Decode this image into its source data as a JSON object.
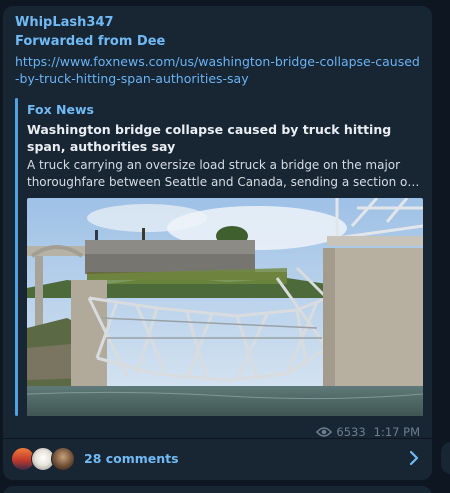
{
  "message": {
    "author": "WhipLash347",
    "forwarded_from": "Forwarded from Dee",
    "link": "https://www.foxnews.com/us/washington-bridge-collapse-caused-by-truck-hitting-span-authorities-say"
  },
  "preview": {
    "site_name": "Fox News",
    "title": "Washington bridge collapse caused by truck hitting span, authorities say",
    "description": "A truck carrying an oversize load struck a bridge on the major thoroughfare between Seattle and Canada, sending a section of the"
  },
  "meta": {
    "views": "6533",
    "time": "1:17 PM",
    "views_icon": "eye-icon"
  },
  "comments": {
    "label": "28 comments",
    "arrow_icon": "chevron-right-icon"
  },
  "colors": {
    "background": "#0e1621",
    "bubble": "#182533",
    "accent": "#71baf5",
    "link": "#6ab3f3",
    "meta": "#6d7f8f"
  }
}
